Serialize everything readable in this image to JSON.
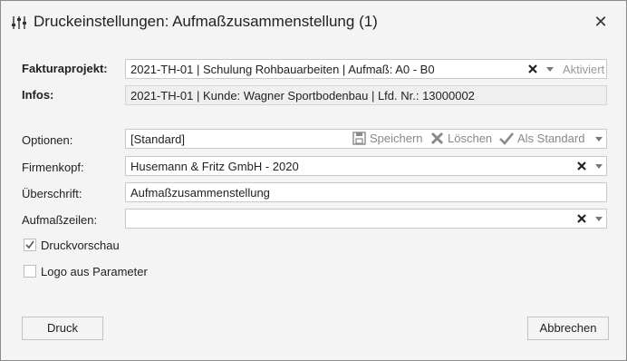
{
  "window": {
    "title": "Druckeinstellungen: Aufmaßzusammenstellung (1)",
    "close_glyph": "✕",
    "icon": "sliders-icon"
  },
  "form": {
    "fakturaprojekt": {
      "label": "Fakturaprojekt:",
      "value": "2021-TH-01 | Schulung Rohbauarbeiten | Aufmaß: A0 - B0",
      "suffix": "Aktiviert"
    },
    "infos": {
      "label": "Infos:",
      "value": "2021-TH-01 | Kunde: Wagner Sportbodenbau | Lfd. Nr.: 13000002"
    },
    "optionen": {
      "label": "Optionen:",
      "value": "[Standard]",
      "save_label": "Speichern",
      "delete_label": "Löschen",
      "default_label": "Als Standard"
    },
    "firmenkopf": {
      "label": "Firmenkopf:",
      "value": "Husemann & Fritz GmbH - 2020"
    },
    "ueberschrift": {
      "label": "Überschrift:",
      "value": "Aufmaßzusammenstellung"
    },
    "aufmasszeilen": {
      "label": "Aufmaßzeilen:",
      "value": ""
    },
    "druckvorschau": {
      "label": "Druckvorschau",
      "checked": true
    },
    "logo": {
      "label": "Logo aus Parameter",
      "checked": false
    }
  },
  "buttons": {
    "print_label": "Druck",
    "cancel_label": "Abbrechen"
  },
  "colors": {
    "window_bg": "#f4f4f4",
    "border": "#c9c9c9",
    "icon_gray": "#888888",
    "clear_icon": "#222222"
  }
}
